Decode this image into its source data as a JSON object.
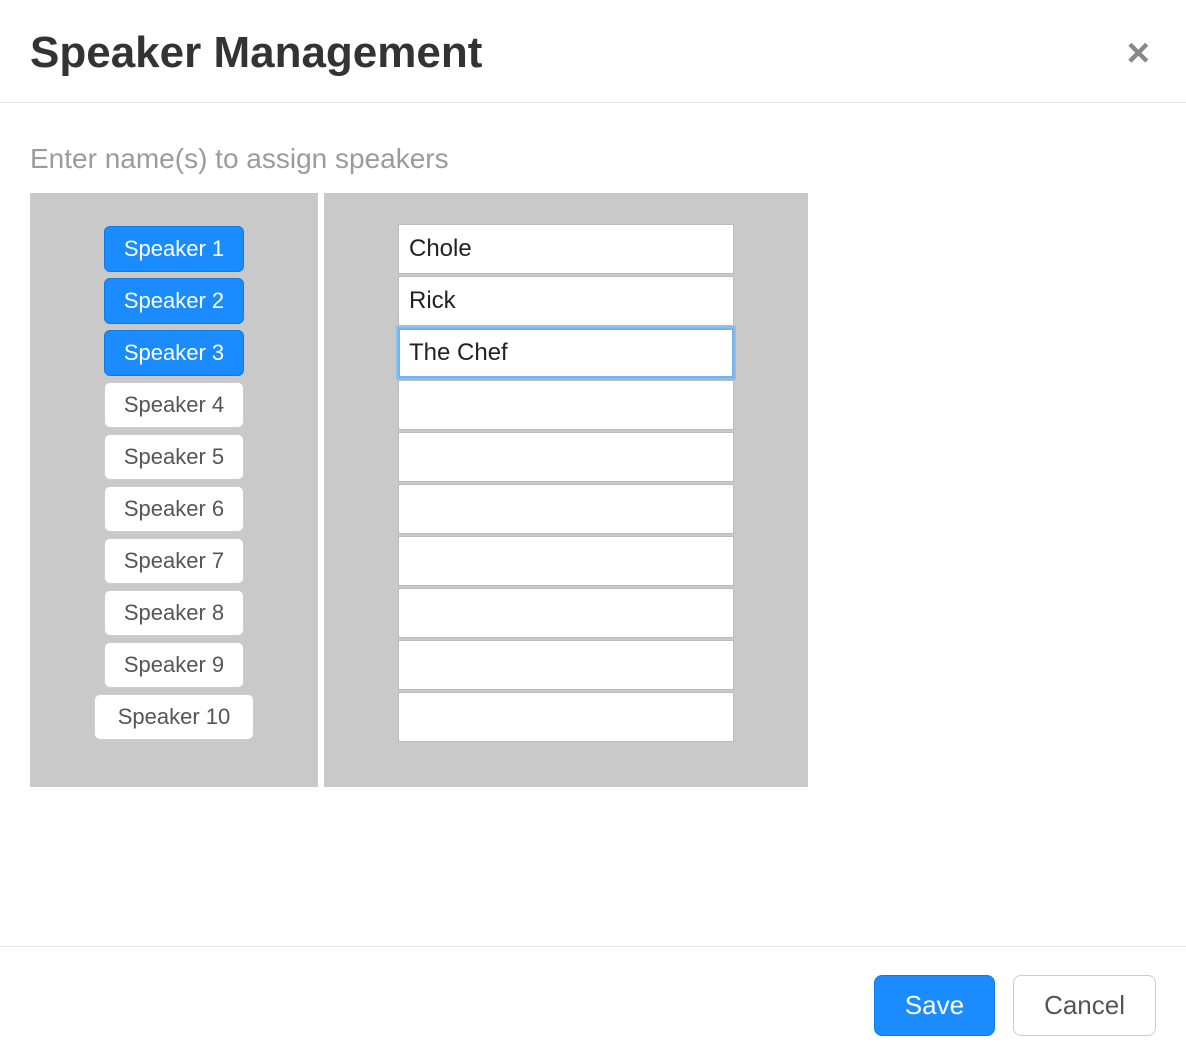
{
  "header": {
    "title": "Speaker Management",
    "close_label": "×"
  },
  "body": {
    "instructions": "Enter name(s) to assign speakers",
    "speakers": [
      {
        "label": "Speaker 1",
        "active": true,
        "name": "Chole",
        "focused": false
      },
      {
        "label": "Speaker 2",
        "active": true,
        "name": "Rick",
        "focused": false
      },
      {
        "label": "Speaker 3",
        "active": true,
        "name": "The Chef",
        "focused": true
      },
      {
        "label": "Speaker 4",
        "active": false,
        "name": "",
        "focused": false
      },
      {
        "label": "Speaker 5",
        "active": false,
        "name": "",
        "focused": false
      },
      {
        "label": "Speaker 6",
        "active": false,
        "name": "",
        "focused": false
      },
      {
        "label": "Speaker 7",
        "active": false,
        "name": "",
        "focused": false
      },
      {
        "label": "Speaker 8",
        "active": false,
        "name": "",
        "focused": false
      },
      {
        "label": "Speaker 9",
        "active": false,
        "name": "",
        "focused": false
      },
      {
        "label": "Speaker 10",
        "active": false,
        "name": "",
        "focused": false
      }
    ]
  },
  "footer": {
    "save_label": "Save",
    "cancel_label": "Cancel"
  },
  "colors": {
    "primary": "#1a8cff",
    "panel_bg": "#c9c9c9"
  }
}
